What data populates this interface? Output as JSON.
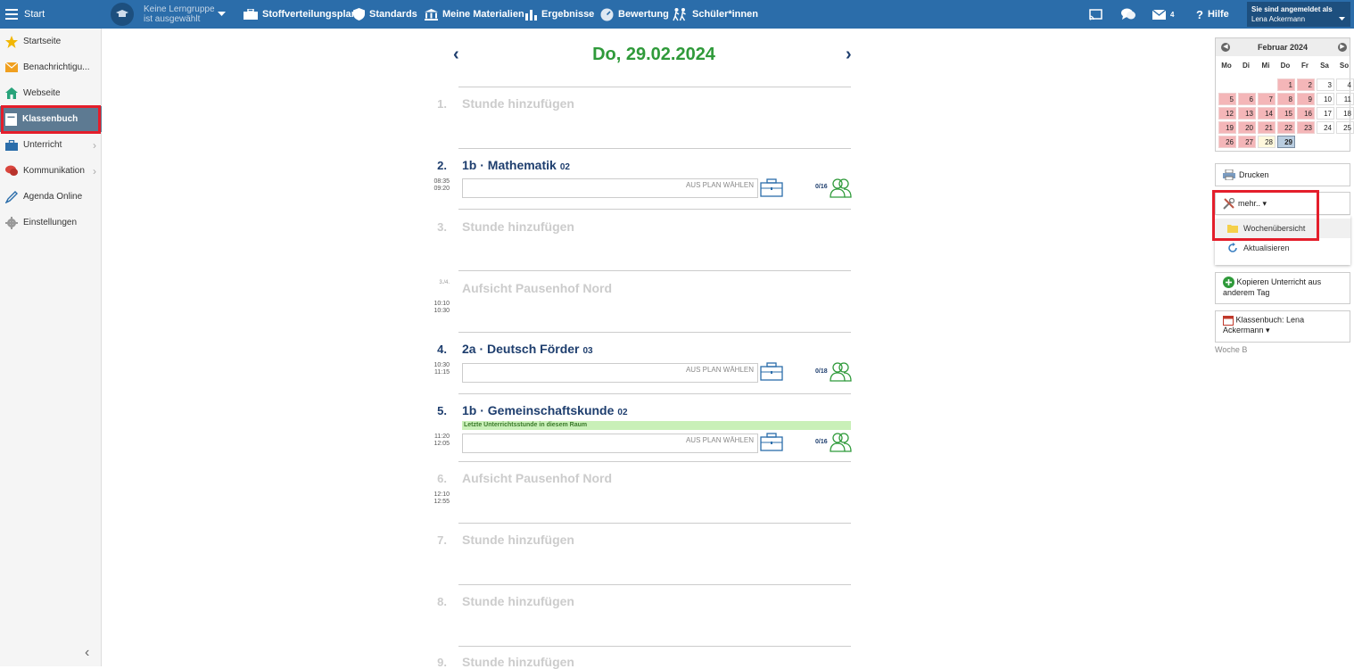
{
  "topbar": {
    "start_label": "Start",
    "group_line1": "Keine Lerngruppe",
    "group_line2": "ist ausgewählt",
    "nav": [
      "Stoffverteilungsplan",
      "Standards",
      "Meine Materialien",
      "Ergebnisse",
      "Bewertung",
      "Schüler*innen"
    ],
    "mail_count": "4",
    "help_label": "Hilfe",
    "login_line1": "Sie sind angemeldet als",
    "login_line2": "Lena Ackermann",
    "color": "#2b6daa"
  },
  "sidebar": {
    "items": [
      {
        "label": "Startseite",
        "icon": "star-icon"
      },
      {
        "label": "Benachrichtigu...",
        "icon": "envelope-icon"
      },
      {
        "label": "Webseite",
        "icon": "home-icon"
      },
      {
        "label": "Klassenbuch",
        "icon": "book-icon"
      },
      {
        "label": "Unterricht",
        "icon": "briefcase-icon"
      },
      {
        "label": "Kommunikation",
        "icon": "chat-icon"
      },
      {
        "label": "Agenda Online",
        "icon": "pen-icon"
      },
      {
        "label": "Einstellungen",
        "icon": "gear-icon"
      }
    ]
  },
  "day": {
    "date": "Do, 29.02.2024",
    "date_color": "#2f9a3a"
  },
  "lessons": [
    {
      "num": "1.",
      "title": "Stunde hinzufügen"
    },
    {
      "num": "2.",
      "title": "1b · Mathematik",
      "room": "02",
      "start": "08:35",
      "end": "09:20",
      "plan": "AUS PLAN WÄHLEN",
      "attendance": "0/16"
    },
    {
      "num": "3.",
      "title": "Stunde hinzufügen"
    },
    {
      "num": "3./4.",
      "title": "Aufsicht  Pausenhof Nord",
      "start": "10:10",
      "end": "10:30"
    },
    {
      "num": "4.",
      "title": "2a · Deutsch Förder",
      "room": "03",
      "start": "10:30",
      "end": "11:15",
      "plan": "AUS PLAN WÄHLEN",
      "attendance": "0/18"
    },
    {
      "num": "5.",
      "title": "1b · Gemeinschaftskunde",
      "room": "02",
      "start": "11:20",
      "end": "12:05",
      "note": "Letzte Unterrichtsstunde in diesem Raum",
      "plan": "AUS PLAN WÄHLEN",
      "attendance": "0/16"
    },
    {
      "num": "6.",
      "title": "Aufsicht  Pausenhof Nord",
      "start": "12:10",
      "end": "12:55"
    },
    {
      "num": "7.",
      "title": "Stunde hinzufügen"
    },
    {
      "num": "8.",
      "title": "Stunde hinzufügen"
    },
    {
      "num": "9.",
      "title": "Stunde hinzufügen"
    }
  ],
  "calendar": {
    "month": "Februar 2024",
    "weekdays": [
      "Mo",
      "Di",
      "Mi",
      "Do",
      "Fr",
      "Sa",
      "So"
    ],
    "days": [
      "1",
      "2",
      "3",
      "4",
      "5",
      "6",
      "7",
      "8",
      "9",
      "10",
      "11",
      "12",
      "13",
      "14",
      "15",
      "16",
      "17",
      "18",
      "19",
      "20",
      "21",
      "22",
      "23",
      "24",
      "25",
      "26",
      "27",
      "28",
      "29"
    ],
    "selected": "29",
    "holiday_color": "#f4b6b8"
  },
  "right": {
    "print": "Drucken",
    "more": "mehr.. ▾",
    "menu_items": [
      "Wochenübersicht",
      "Aktualisieren"
    ],
    "copy": "Kopieren Unterricht aus anderem Tag",
    "book": "Klassenbuch: Lena Ackermann ▾",
    "week": "Woche B"
  }
}
